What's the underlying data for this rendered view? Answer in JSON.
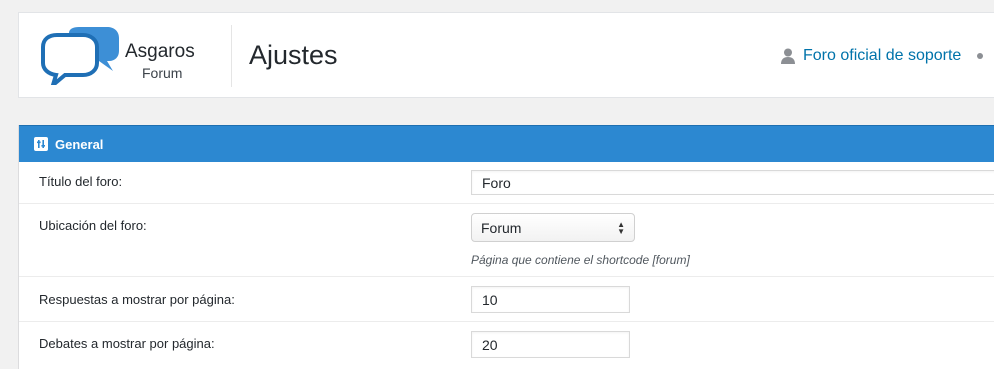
{
  "header": {
    "logo_name": "Asgaros",
    "logo_sub": "Forum",
    "title": "Ajustes",
    "support_link": "Foro oficial de soporte",
    "user_icon": "user-icon",
    "logo_icon": "speech-bubbles-icon"
  },
  "panel": {
    "title": "General",
    "icon": "sliders-icon",
    "accent_color": "#2c88d1"
  },
  "settings": {
    "forum_title": {
      "label": "Título del foro:",
      "value": "Foro"
    },
    "forum_location": {
      "label": "Ubicación del foro:",
      "value": "Forum",
      "hint": "Página que contiene el shortcode [forum]"
    },
    "replies_per_page": {
      "label": "Respuestas a mostrar por página:",
      "value": "10"
    },
    "topics_per_page": {
      "label": "Debates a mostrar por página:",
      "value": "20"
    }
  }
}
